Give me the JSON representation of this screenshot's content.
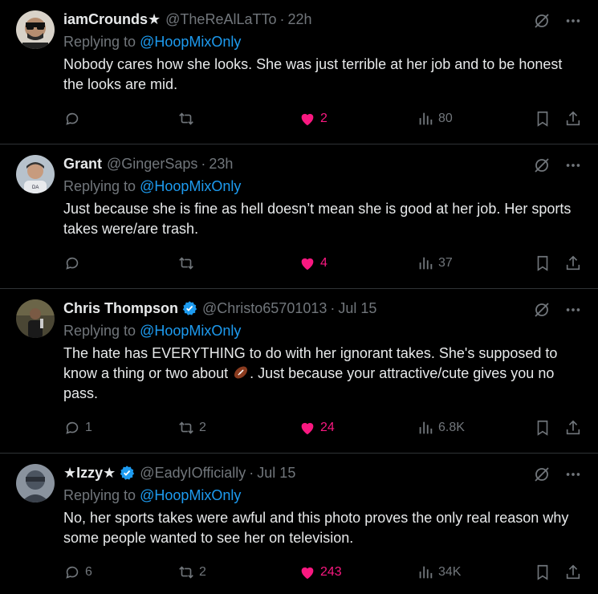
{
  "tweets": [
    {
      "name": "iamCrounds★",
      "verified": false,
      "handle": "@TheReAlLaTTo",
      "time": "22h",
      "reply_prefix": "Replying to",
      "reply_to": "@HoopMixOnly",
      "text": "Nobody cares how she looks. She was just terrible at her job and to be honest the looks are mid.",
      "replies": "",
      "retweets": "",
      "likes": "2",
      "views": "80",
      "avatar_color": "#c9c3bb"
    },
    {
      "name": "Grant",
      "verified": false,
      "handle": "@GingerSaps",
      "time": "23h",
      "reply_prefix": "Replying to",
      "reply_to": "@HoopMixOnly",
      "text": "Just because she is fine as hell doesn’t mean she is good at her job. Her sports takes were/are trash.",
      "replies": "",
      "retweets": "",
      "likes": "4",
      "views": "37",
      "avatar_color": "#9aa3ad"
    },
    {
      "name": "Chris Thompson",
      "verified": true,
      "handle": "@Christo65701013",
      "time": "Jul 15",
      "reply_prefix": "Replying to",
      "reply_to": "@HoopMixOnly",
      "text_before_emoji": "The hate has EVERYTHING to do with her ignorant takes. She's supposed to know a thing or two about ",
      "text_after_emoji": ". Just because your attractive/cute gives you no pass.",
      "emoji": "american-football-emoji",
      "replies": "1",
      "retweets": "2",
      "likes": "24",
      "views": "6.8K",
      "avatar_color": "#3b3a2c"
    },
    {
      "name": "★Izzy★",
      "verified": true,
      "handle": "@EadyIOfficially",
      "time": "Jul 15",
      "reply_prefix": "Replying to",
      "reply_to": "@HoopMixOnly",
      "text": "No, her sports takes were awful and this photo proves the only real reason why some people wanted to see her on television.",
      "replies": "6",
      "retweets": "2",
      "likes": "243",
      "views": "34K",
      "avatar_color": "#6d7681"
    }
  ],
  "icons": {
    "reply": "reply-icon",
    "retweet": "retweet-icon",
    "like": "heart-icon",
    "views": "views-icon",
    "bookmark": "bookmark-icon",
    "share": "share-icon",
    "grok": "grok-icon",
    "more": "more-icon",
    "verified": "verified-badge-icon"
  },
  "colors": {
    "background": "#000000",
    "text": "#e7e9ea",
    "muted": "#71767b",
    "link": "#1d9bf0",
    "like": "#f91880",
    "divider": "#2f3336"
  }
}
